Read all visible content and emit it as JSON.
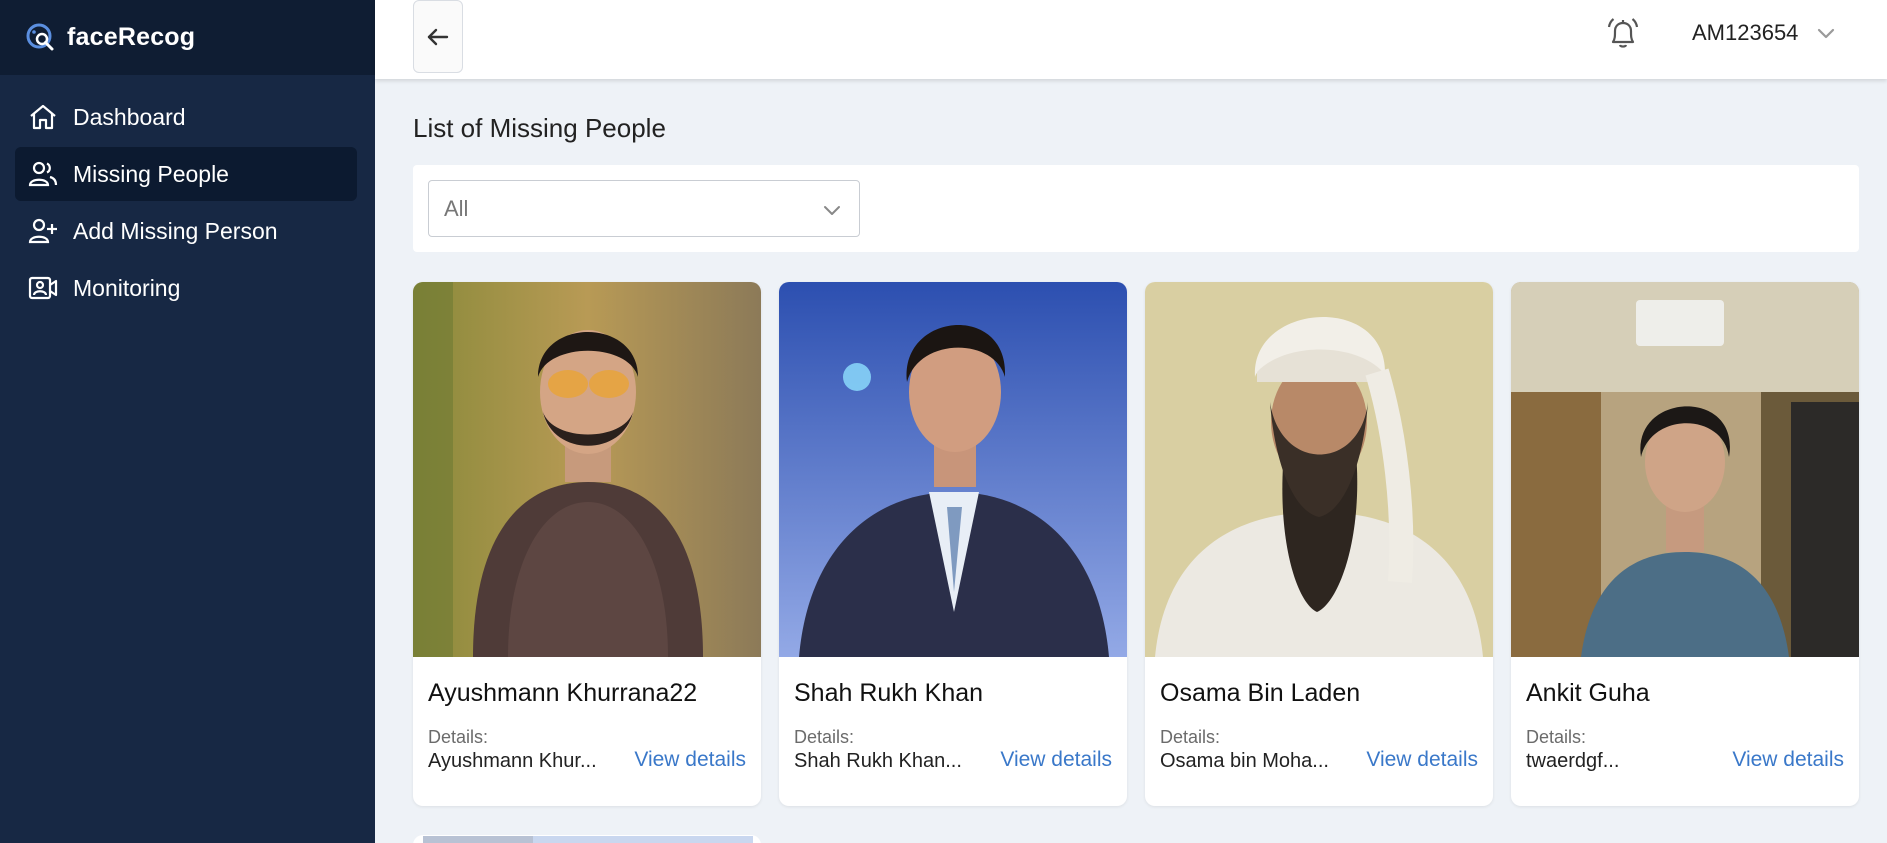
{
  "app": {
    "name": "faceRecog",
    "logo_icon": "face-search-icon"
  },
  "sidebar": {
    "items": [
      {
        "label": "Dashboard",
        "icon": "home-icon",
        "active": false
      },
      {
        "label": "Missing People",
        "icon": "users-icon",
        "active": true
      },
      {
        "label": "Add Missing Person",
        "icon": "user-plus-icon",
        "active": false
      },
      {
        "label": "Monitoring",
        "icon": "camera-icon",
        "active": false
      }
    ]
  },
  "header": {
    "back_icon": "arrow-left-icon",
    "notification_icon": "bell-icon",
    "user_id": "AM123654",
    "user_menu_icon": "chevron-down-icon"
  },
  "main": {
    "title": "List of Missing People",
    "filter": {
      "selected": "All"
    },
    "cards": [
      {
        "name": "Ayushmann Khurrana22",
        "details_label": "Details:",
        "details": "Ayushmann Khur...",
        "link": "View details"
      },
      {
        "name": "Shah Rukh Khan",
        "details_label": "Details:",
        "details": "Shah Rukh Khan...",
        "link": "View details"
      },
      {
        "name": "Osama Bin Laden",
        "details_label": "Details:",
        "details": "Osama bin Moha...",
        "link": "View details"
      },
      {
        "name": "Ankit Guha",
        "details_label": "Details:",
        "details": "twaerdgf...",
        "link": "View details"
      }
    ]
  },
  "colors": {
    "sidebar_bg": "#172844",
    "sidebar_brand_bg": "#0f1d33",
    "active_item_bg": "#0c1a30",
    "page_bg": "#eef2f7",
    "link": "#3a78c9"
  }
}
